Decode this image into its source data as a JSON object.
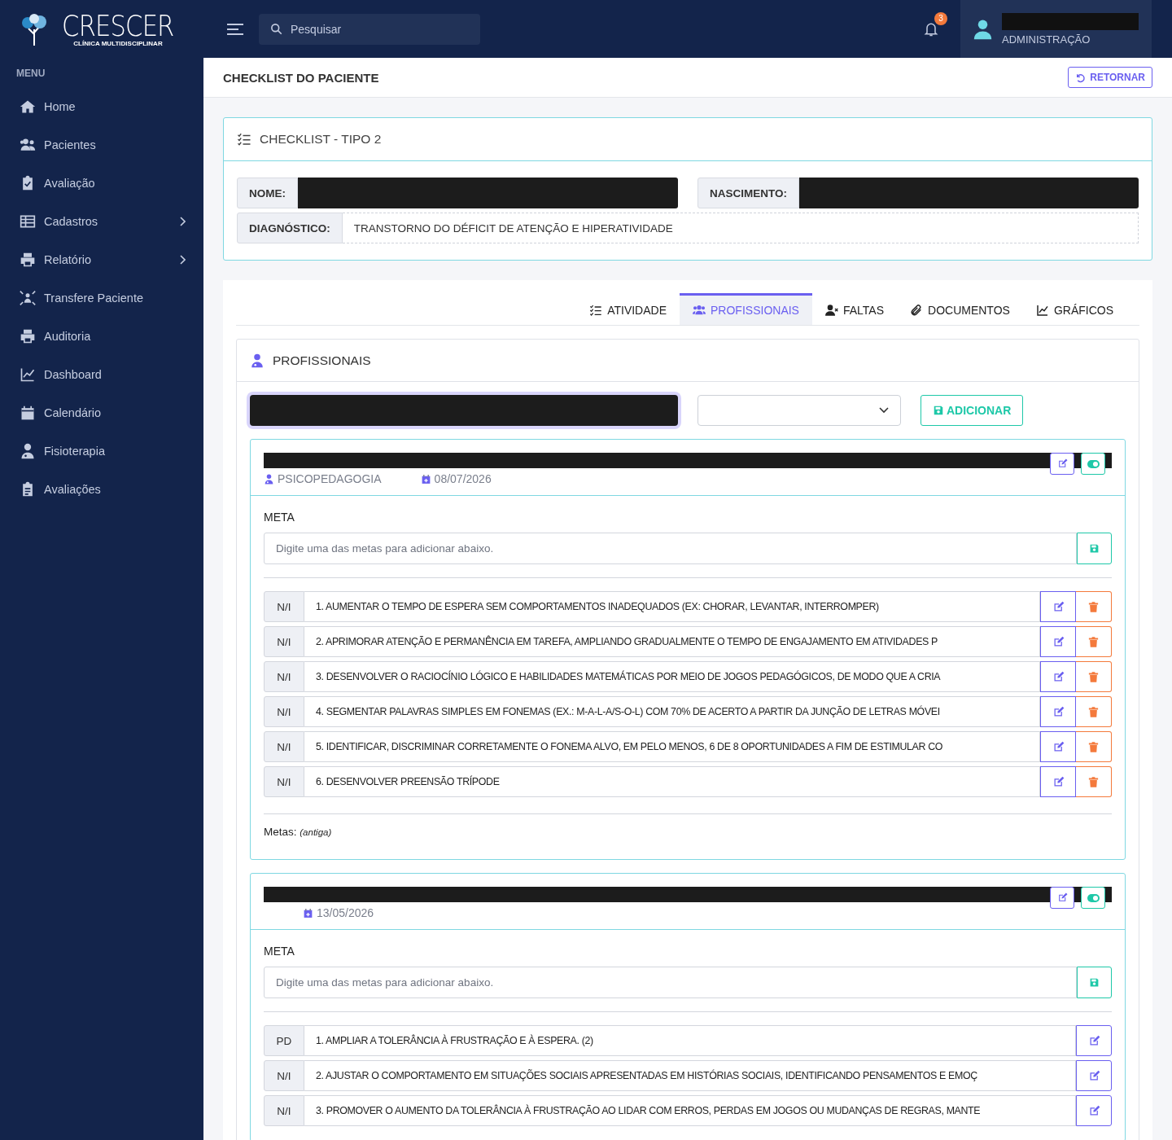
{
  "brand": {
    "name": "CRESCER",
    "tagline": "CLÍNICA MULTIDISCIPLINAR"
  },
  "sidebar": {
    "heading": "MENU",
    "items": [
      {
        "label": "Home",
        "has_submenu": false
      },
      {
        "label": "Pacientes",
        "has_submenu": false
      },
      {
        "label": "Avaliação",
        "has_submenu": false
      },
      {
        "label": "Cadastros",
        "has_submenu": true
      },
      {
        "label": "Relatório",
        "has_submenu": true
      },
      {
        "label": "Transfere Paciente",
        "has_submenu": false
      },
      {
        "label": "Auditoria",
        "has_submenu": false
      },
      {
        "label": "Dashboard",
        "has_submenu": false
      },
      {
        "label": "Calendário",
        "has_submenu": false
      },
      {
        "label": "Fisioterapia",
        "has_submenu": false
      },
      {
        "label": "Avaliações",
        "has_submenu": false
      }
    ]
  },
  "topbar": {
    "search": {
      "placeholder": "Pesquisar"
    },
    "notifications": "3",
    "user": {
      "role": "ADMINISTRAÇÃO"
    }
  },
  "page": {
    "title": "CHECKLIST DO PACIENTE",
    "back_button": "RETORNAR"
  },
  "checklist": {
    "title": "CHECKLIST - TIPO 2",
    "fields": [
      {
        "label": "NOME:"
      },
      {
        "label": "NASCIMENTO:"
      },
      {
        "label": "DIAGNÓSTICO:",
        "value": "TRANSTORNO DO DÉFICIT DE ATENÇÃO E HIPERATIVIDADE"
      }
    ]
  },
  "tabs": [
    {
      "label": "ATIVIDADE",
      "selected": false
    },
    {
      "label": "PROFISSIONAIS",
      "selected": true
    },
    {
      "label": "FALTAS",
      "selected": false
    },
    {
      "label": "DOCUMENTOS",
      "selected": false
    },
    {
      "label": "GRÁFICOS",
      "selected": false
    }
  ],
  "section": {
    "title": "PROFISSIONAIS",
    "add_button": "ADICIONAR"
  },
  "cards": [
    {
      "specialty": "PSICOPEDAGOGIA",
      "date": "08/07/2026",
      "meta_label": "META",
      "meta_placeholder": "Digite uma das metas para adicionar abaixo.",
      "goals": [
        {
          "status": "N/I",
          "text": "1. AUMENTAR O TEMPO DE ESPERA SEM  COMPORTAMENTOS INADEQUADOS (EX:  CHORAR, LEVANTAR, INTERROMPER)",
          "deletable": true
        },
        {
          "status": "N/I",
          "text": "2. APRIMORAR ATENÇÃO E PERMANÊNCIA EM  TAREFA,  AMPLIANDO GRADUALMENTE O  TEMPO DE ENGAJAMENTO EM ATIVIDADES  P",
          "deletable": true
        },
        {
          "status": "N/I",
          "text": "3. DESENVOLVER O RACIOCÍNIO LÓGICO E  HABILIDADES MATEMÁTICAS POR MEIO DE  JOGOS PEDAGÓGICOS, DE MODO QUE A  CRIA",
          "deletable": true
        },
        {
          "status": "N/I",
          "text": "4. SEGMENTAR PALAVRAS SIMPLES EM  FONEMAS (EX.: M-A-L-A/S-O-L) COM  70% DE ACERTO A PARTIR DA JUNÇÃO DE  LETRAS MÓVEI",
          "deletable": true
        },
        {
          "status": "N/I",
          "text": "5. IDENTIFICAR, DISCRIMINAR CORRETAMENTE O  FONEMA ALVO, EM PELO MENOS, 6 DE 8  OPORTUNIDADES A FIM DE ESTIMULAR  CO",
          "deletable": true
        },
        {
          "status": "N/I",
          "text": "6. DESENVOLVER PREENSÃO TRÍPODE",
          "deletable": true
        }
      ],
      "footer": {
        "label": "Metas:",
        "note": "(antiga)"
      }
    },
    {
      "date": "13/05/2026",
      "meta_label": "META",
      "meta_placeholder": "Digite uma das metas para adicionar abaixo.",
      "goals": [
        {
          "status": "PD",
          "text": "1. AMPLIAR A TOLERÂNCIA À FRUSTRAÇÃO E À  ESPERA. (2)",
          "deletable": false
        },
        {
          "status": "N/I",
          "text": "2. AJUSTAR O COMPORTAMENTO EM SITUAÇÕES  SOCIAIS APRESENTADAS EM HISTÓRIAS  SOCIAIS, IDENTIFICANDO PENSAMENTOS E  EMOÇ",
          "deletable": false
        },
        {
          "status": "N/I",
          "text": "3. PROMOVER O AUMENTO DA TOLERÂNCIA À  FRUSTRAÇÃO AO LIDAR COM ERROS, PERDAS  EM JOGOS OU MUDANÇAS DE REGRAS, MANTE",
          "deletable": false
        }
      ]
    }
  ]
}
